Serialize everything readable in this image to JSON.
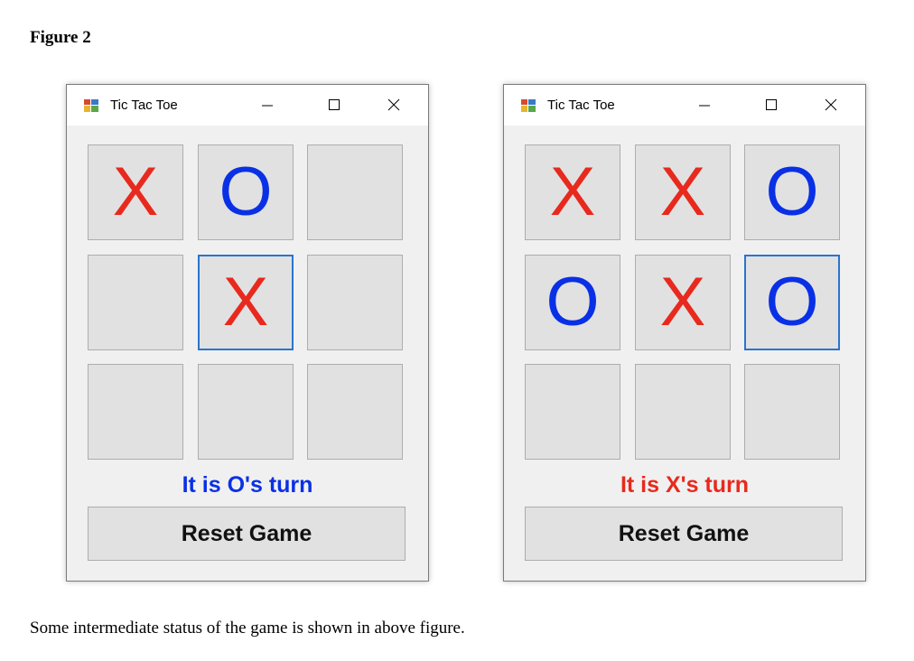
{
  "figure_title": "Figure 2",
  "caption": "Some intermediate status of the game is shown in above figure.",
  "windows": [
    {
      "title": "Tic Tac Toe",
      "board": [
        "X",
        "O",
        "",
        "",
        "X",
        "",
        "",
        "",
        ""
      ],
      "selected_cell": 4,
      "status": "It is O's turn",
      "status_color": "#0a30e6",
      "reset_label": "Reset Game"
    },
    {
      "title": "Tic Tac Toe",
      "board": [
        "X",
        "X",
        "O",
        "O",
        "X",
        "O",
        "",
        "",
        ""
      ],
      "selected_cell": 5,
      "status": "It is X's turn",
      "status_color": "#e8291d",
      "reset_label": "Reset Game"
    }
  ],
  "colors": {
    "x": "#e8291d",
    "o": "#0a30e6",
    "selection_border": "#2a74cf"
  },
  "icons": {
    "app": "app-window-icon",
    "minimize": "minimize-icon",
    "maximize": "maximize-icon",
    "close": "close-icon"
  }
}
